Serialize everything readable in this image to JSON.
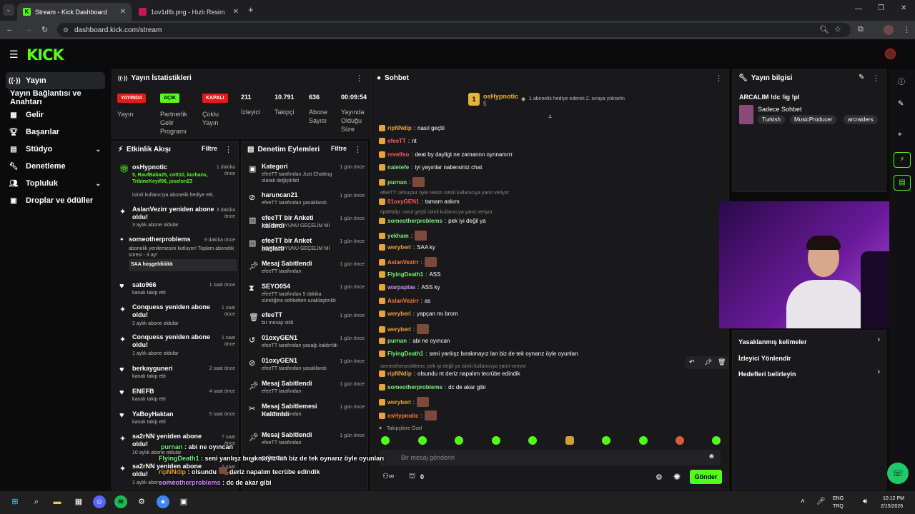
{
  "browser": {
    "tabs": [
      {
        "label": "Stream - Kick Dashboard"
      },
      {
        "label": "1ov1dfb.png - Hızlı Resim"
      }
    ],
    "url": "dashboard.kick.com/stream"
  },
  "header": {
    "logo": "KICK"
  },
  "sidebar": {
    "items": [
      {
        "label": "Yayın"
      },
      {
        "label": "Yayın Bağlantısı ve Anahtarı"
      },
      {
        "label": "Gelir"
      },
      {
        "label": "Başarılar"
      },
      {
        "label": "Stüdyo"
      },
      {
        "label": "Denetleme"
      },
      {
        "label": "Topluluk"
      },
      {
        "label": "Droplar ve ödüller"
      }
    ]
  },
  "stats": {
    "title": "Yayın İstatistikleri",
    "badges": [
      {
        "label": "YAYINDA",
        "name": "Yayın"
      },
      {
        "label": "AÇIK",
        "name": "Partnerlik Gelir Programı"
      },
      {
        "label": "KAPALI",
        "name": "Çoklu Yayın"
      }
    ],
    "nums": [
      {
        "value": "211",
        "label": "İzleyici"
      },
      {
        "value": "10.791",
        "label": "Takipçi"
      },
      {
        "value": "636",
        "label": "Abone Sayısı"
      },
      {
        "value": "00:09:54",
        "label": "Yayında Olduğu Süre"
      }
    ]
  },
  "feed": {
    "title": "Etkinlik Akışı",
    "filter": "Filtre",
    "events": [
      {
        "title": "osHypnotic",
        "time": "1 dakika önce",
        "sub": "5, RaufBaba25, cott10, kurbanx, TribineKeyif06, joselon23",
        "sub2": "isimli kullanıcıya abonelik hediye etti."
      },
      {
        "title": "AslanVezirr yeniden abone oldu!",
        "time": "3 dakika önce",
        "sub": "3 aylık abone oldular"
      },
      {
        "title": "someotherproblems",
        "time": "9 dakika önce",
        "sub": "abonelik yenilemesini kutluyor! Toplam abonelik süresi - 3 ay!",
        "msg": "SAA hoşgeldiiiikk"
      },
      {
        "title": "sato966",
        "time": "1 saat önce",
        "sub": "kanalı takip etti"
      },
      {
        "title": "Conquess yeniden abone oldu!",
        "time": "1 saat önce",
        "sub": "2 aylık abone oldular"
      },
      {
        "title": "Conquess yeniden abone oldu!",
        "time": "1 saat önce",
        "sub": "1 aylık abone oldular"
      },
      {
        "title": "berkayguneri",
        "time": "2 saat önce",
        "sub": "kanalı takip etti"
      },
      {
        "title": "ENEFB",
        "time": "4 saat önce",
        "sub": "kanalı takip etti"
      },
      {
        "title": "YaBoyHaktan",
        "time": "5 saat önce",
        "sub": "kanalı takip etti"
      },
      {
        "title": "sa2rNN yeniden abone oldu!",
        "time": "7 saat önce",
        "sub": "10 aylık abone oldular"
      },
      {
        "title": "sa2rNN yeniden abone oldu!",
        "time": "7 saat önce",
        "sub": "1 aylık abone oldular"
      }
    ]
  },
  "modlog": {
    "title": "Denetim Eylemleri",
    "filter": "Filtre",
    "items": [
      {
        "title": "Kategori",
        "time": "1 gün önce",
        "sub": "efeeTT tarafından Just Chatting olarak değiştirildi"
      },
      {
        "title": "haruncan21",
        "time": "1 gün önce",
        "sub": "efeeTT tarafından yasaklandı"
      },
      {
        "title": "efeeTT bir Anketi kaldırdı",
        "time": "1 gün önce",
        "sub": "KORKU OYUNU GEÇELİM Mİ"
      },
      {
        "title": "efeeTT bir Anket başlattı",
        "time": "1 gün önce",
        "sub": "KORKU OYUNU GEÇELİM Mİ"
      },
      {
        "title": "Mesaj Sabitlendi",
        "time": "1 gün önce",
        "sub": "efeeTT tarafından"
      },
      {
        "title": "SEYO054",
        "time": "1 gün önce",
        "sub": "efeeTT tarafından 5 dakika süreliğine sohbetten uzaklaştırıldı"
      },
      {
        "title": "efeeTT",
        "time": "1 gün önce",
        "sub": "bir mesajı sildi"
      },
      {
        "title": "01oxyGEN1",
        "time": "1 gün önce",
        "sub": "efeeTT tarafından yasağı kaldırıldı"
      },
      {
        "title": "01oxyGEN1",
        "time": "1 gün önce",
        "sub": "efeeTT tarafından yasaklandı"
      },
      {
        "title": "Mesaj Sabitlendi",
        "time": "1 gün önce",
        "sub": "efeeTT tarafından"
      },
      {
        "title": "Mesaj Sabitlemesi Kaldırıldı",
        "time": "1 gün önce",
        "sub": "efeeTT tarafından"
      },
      {
        "title": "Mesaj Sabitlendi",
        "time": "1 gün önce",
        "sub": "efeeTT tarafından"
      },
      {
        "title": "primeus",
        "time": "",
        "sub": ""
      }
    ]
  },
  "chat": {
    "title": "Sohbet",
    "pinned_user": "osHypnotic",
    "pinned_count": "5",
    "pinned_text": "1 abonelik hediye ederek 2. sıraya yükselin",
    "placeholder": "Bir mesaj gönderin",
    "send": "Gönder",
    "points": "0",
    "followers_only": "Takipçilere Özel",
    "messages": [
      {
        "user": "ripNNdip",
        "text": "nasıl geçtii",
        "color": "#e8a33a"
      },
      {
        "user": "efeeTT",
        "text": "nt",
        "color": "#ff5a5a"
      },
      {
        "user": "revellso",
        "text": "deat by dayligt ne zamannn oynnanırrr",
        "color": "#ff5a5a"
      },
      {
        "user": "naletefe",
        "text": "iyi yayınlar nabersiniz chat",
        "color": "#7af07a"
      },
      {
        "user": "purnan",
        "text": "",
        "color": "#7af07a"
      },
      {
        "reply": "efeeTT: olmuştur öyle reisim isimli kullanıcıya yanıt veriyor"
      },
      {
        "user": "01oxyGEN1",
        "text": "tamam askım",
        "color": "#ff5a5a"
      },
      {
        "reply": "ripNNdip: nasıl geçtii isimli kullanıcıya yanıt veriyor"
      },
      {
        "user": "someotherproblems",
        "text": "pek iyi değil ya",
        "color": "#7af07a"
      },
      {
        "user": "yekham",
        "text": "",
        "color": "#7af07a"
      },
      {
        "user": "weryberi",
        "text": "SAA ky",
        "color": "#e8a33a"
      },
      {
        "user": "AslanVezirr",
        "text": "",
        "color": "#ff7a3a"
      },
      {
        "user": "FlyingDeath1",
        "text": "ASS",
        "color": "#7af07a"
      },
      {
        "user": "warpaplas",
        "text": "ASS ky",
        "color": "#d08aff"
      },
      {
        "user": "AslanVezirr",
        "text": "as",
        "color": "#ff7a3a"
      },
      {
        "user": "weryberi",
        "text": "yapçan mı brom",
        "color": "#e8a33a"
      },
      {
        "user": "weryberi",
        "text": "",
        "color": "#e8a33a"
      },
      {
        "user": "purnan",
        "text": "abi ne oyıncan",
        "color": "#7af07a"
      },
      {
        "user": "FlyingDeath1",
        "text": "seni yanlışz bırakmayız lan biz de tek oynarız öyle oyunları",
        "color": "#7af07a"
      },
      {
        "reply": "someotherproblems: pek iyi değil ya isimli kullanıcıya yanıt veriyor"
      },
      {
        "user": "ripNNdip",
        "text": "olsundu nt deriz napalım tecrübe edindik",
        "color": "#e8a33a"
      },
      {
        "user": "someotherproblems",
        "text": "dc de akar gibi",
        "color": "#7af07a"
      },
      {
        "user": "weryberi",
        "text": "",
        "color": "#e8a33a"
      },
      {
        "user": "osHypnotic",
        "text": "",
        "color": "#ff7a3a"
      }
    ]
  },
  "info": {
    "title": "Yayın bilgisi",
    "stream_title": "ARCALIM !dc !ig !pl",
    "category": "Sadece Sohbet",
    "tags": [
      "Turkish",
      "MusicProducer",
      "arcraiders"
    ],
    "links": [
      {
        "label": "Yasaklanmış kelimeler"
      },
      {
        "label": "İzleyici Yönlendir"
      },
      {
        "label": "Hedefleri belirleyin"
      }
    ]
  },
  "overlay": {
    "lines": [
      {
        "user": "purnan",
        "text": ": abi ne oyıncan"
      },
      {
        "user": "FlyingDeath1",
        "text": ": seni yanlışz bırakmayız lan biz de tek oynarız öyle oyunları"
      },
      {
        "user": "ripNNdip",
        "text": ": olsundu",
        "text2": "deriz napalım tecrübe edindik"
      },
      {
        "user": "someotherproblems",
        "text": ": dc de akar gibi"
      },
      {
        "user": "weryberi",
        "text": ":"
      },
      {
        "user": "osHypnotic",
        "text": ":"
      }
    ]
  },
  "taskbar": {
    "lang1": "ENG",
    "lang2": "TRQ",
    "time": "10:12 PM",
    "date": "2/15/2026"
  },
  "colors": {
    "accent": "#53fc18",
    "live": "#e91916",
    "panel": "#19191b"
  }
}
